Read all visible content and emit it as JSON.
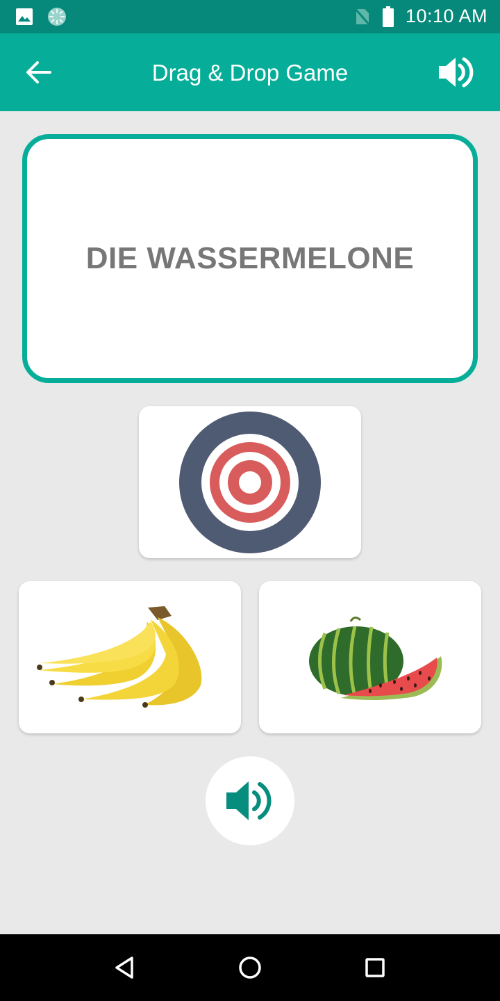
{
  "status_bar": {
    "time": "10:10 AM",
    "icons": [
      "image-icon",
      "spinner-icon",
      "no-sim-icon",
      "battery-icon"
    ]
  },
  "app_bar": {
    "title": "Drag & Drop Game",
    "icons": [
      "back-arrow-icon",
      "speaker-icon"
    ]
  },
  "word_card": {
    "word": "DIE WASSERMELONE"
  },
  "target": {
    "icon": "target-icon"
  },
  "options": [
    {
      "name": "banana"
    },
    {
      "name": "watermelon"
    }
  ],
  "play_button": {
    "icon": "speaker-icon"
  },
  "nav_bar": {
    "icons": [
      "back-triangle-icon",
      "home-circle-icon",
      "recents-square-icon"
    ]
  },
  "colors": {
    "accent": "#06ae99",
    "status_bar": "#06897a",
    "background": "#e8e9e8",
    "word_text": "#777777"
  }
}
